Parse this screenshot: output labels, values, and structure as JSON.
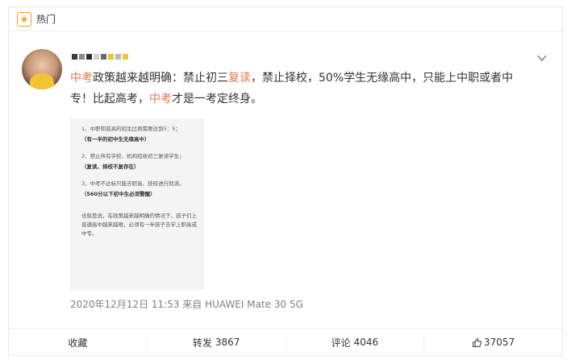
{
  "hot": {
    "label": "热门"
  },
  "post": {
    "segments": [
      {
        "text": "中考",
        "hl": true
      },
      {
        "text": "政策越来越明确：禁止初三",
        "hl": false
      },
      {
        "text": "复读",
        "hl": true
      },
      {
        "text": "，禁止择校，50%学生无缘高中，只能上中职或者中专！比起高考，",
        "hl": false
      },
      {
        "text": "中考",
        "hl": true
      },
      {
        "text": "才是一考定终身。",
        "hl": false
      }
    ],
    "image_text": {
      "item1": "1、中职和普高的招生比例需要达到5：5；",
      "item1_note": "（有一半的初中生无缘高中）",
      "item2": "2、禁止所有学校、机构招收初三复读学生；",
      "item2_note": "（复读、择校不复存在）",
      "item3": "3、中考不达标只能去职高、技校进行就读。",
      "item3_note": "（560分以下初中生必须警醒）",
      "summary": "也就是说，在政策越来越明确的情况下，孩子们上普通高中越来越难，必须有一半孩子去学上职高或中专。"
    },
    "meta": "2020年12月12日 11:53  来自 HUAWEI Mate 30 5G"
  },
  "actions": {
    "favorite": "收藏",
    "repost_label": "转发",
    "repost_count": "3867",
    "comment_label": "评论",
    "comment_count": "4046",
    "like_count": "37057"
  },
  "colors": {
    "highlight": "#eb7350",
    "star": "#f0a020"
  }
}
